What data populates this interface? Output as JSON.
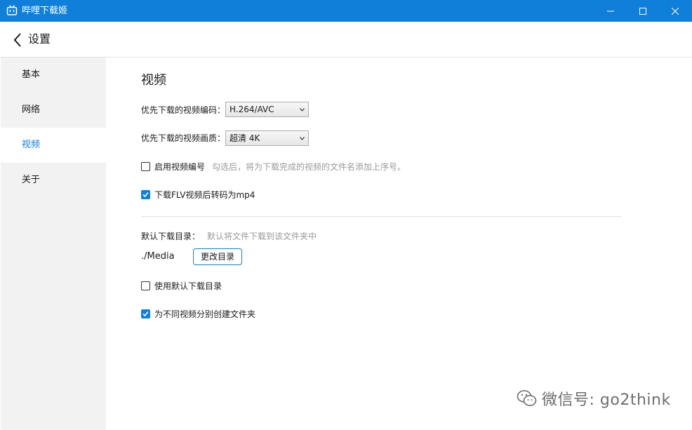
{
  "window": {
    "title": "哔哩下载姬",
    "titlebar_color": "#0f7fd9"
  },
  "header": {
    "title": "设置"
  },
  "sidebar": {
    "items": [
      {
        "label": "基本"
      },
      {
        "label": "网络"
      },
      {
        "label": "视频"
      },
      {
        "label": "关于"
      }
    ],
    "active_index": 2
  },
  "video": {
    "section_title": "视频",
    "codec": {
      "label": "优先下载的视频编码：",
      "value": "H.264/AVC"
    },
    "quality": {
      "label": "优先下载的视频画质：",
      "value": "超清 4K"
    },
    "numbering": {
      "label": "启用视频编号",
      "checked": false,
      "hint": "勾选后，将为下载完成的视频的文件名添加上序号。"
    },
    "flv_to_mp4": {
      "label": "下载FLV视频后转码为mp4",
      "checked": true
    },
    "download_dir": {
      "label": "默认下载目录：",
      "hint": "默认将文件下载到该文件夹中",
      "path": "./Media",
      "change_button": "更改目录"
    },
    "use_default_dir": {
      "label": "使用默认下载目录",
      "checked": false
    },
    "separate_folders": {
      "label": "为不同视频分别创建文件夹",
      "checked": true
    }
  },
  "watermark": {
    "text": "微信号: go2think"
  },
  "colors": {
    "accent": "#0f7fd9",
    "sidebar_bg": "#f2f2f2",
    "hint_text": "#9a9a9a"
  }
}
